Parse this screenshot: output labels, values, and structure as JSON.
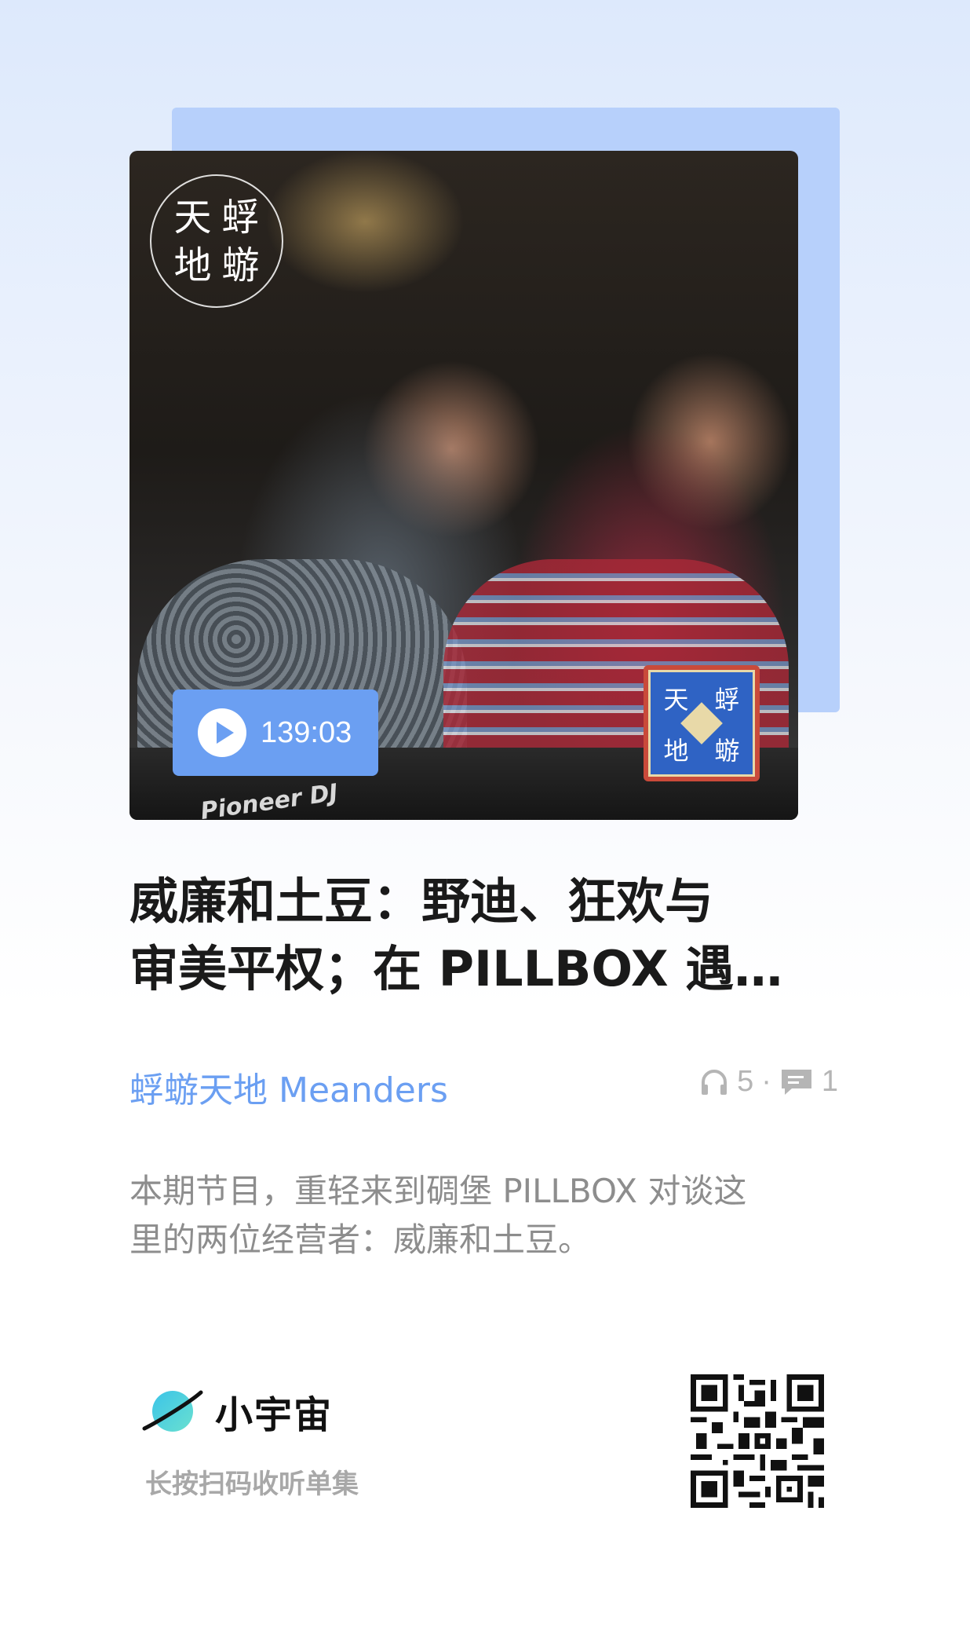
{
  "cover": {
    "logo_chars": [
      "天",
      "蜉",
      "地",
      "蝣"
    ],
    "duration": "139:03",
    "badge_chars": [
      "天",
      "蜉",
      "地",
      "蝣"
    ],
    "deck_brand": "Pioneer DJ"
  },
  "episode": {
    "title": "威廉和土豆：野迪、狂欢与\n审美平权；在 PILLBOX 遇…",
    "podcast_name": "蜉蝣天地 Meanders",
    "plays": "5",
    "separator": "·",
    "comments": "1",
    "description": "本期节目，重轻来到碉堡 PILLBOX 对谈这\n里的两位经营者：威廉和土豆。"
  },
  "footer": {
    "brand": "小宇宙",
    "hint": "长按扫码收听单集"
  },
  "colors": {
    "accent": "#6b9ff2",
    "backcard": "#b7d0fb"
  }
}
